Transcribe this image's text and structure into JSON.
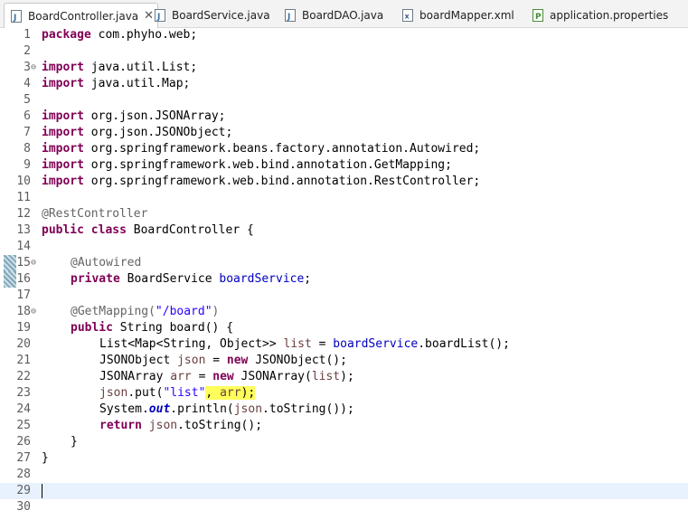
{
  "tabs": [
    {
      "label": "BoardController.java",
      "type": "java",
      "active": true,
      "close": "✕"
    },
    {
      "label": "BoardService.java",
      "type": "java",
      "active": false
    },
    {
      "label": "BoardDAO.java",
      "type": "java",
      "active": false
    },
    {
      "label": "boardMapper.xml",
      "type": "xml",
      "active": false
    },
    {
      "label": "application.properties",
      "type": "properties",
      "active": false
    }
  ],
  "editor": {
    "line_numbers": [
      "1",
      "2",
      "3",
      "4",
      "5",
      "6",
      "7",
      "8",
      "9",
      "10",
      "11",
      "12",
      "13",
      "14",
      "15",
      "16",
      "17",
      "18",
      "19",
      "20",
      "21",
      "22",
      "23",
      "24",
      "25",
      "26",
      "27",
      "28",
      "29",
      "30"
    ],
    "fold_marker": "⊖",
    "code": {
      "l1_kw": "package",
      "l1_rest": " com.phyho.web;",
      "l3_kw": "import",
      "l3_rest": " java.util.List;",
      "l4_kw": "import",
      "l4_rest": " java.util.Map;",
      "l6_kw": "import",
      "l6_rest": " org.json.JSONArray;",
      "l7_kw": "import",
      "l7_rest": " org.json.JSONObject;",
      "l8_kw": "import",
      "l8_rest": " org.springframework.beans.factory.annotation.Autowired;",
      "l9_kw": "import",
      "l9_rest": " org.springframework.web.bind.annotation.GetMapping;",
      "l10_kw": "import",
      "l10_rest": " org.springframework.web.bind.annotation.RestController;",
      "l12_an": "@RestController",
      "l13_kw": "public class",
      "l13_rest": " BoardController {",
      "l15_an": "@Autowired",
      "l16_kw": "private",
      "l16_type": " BoardService ",
      "l16_fld": "boardService",
      "l16_end": ";",
      "l18_an": "@GetMapping(",
      "l18_str": "\"/board\"",
      "l18_end": ")",
      "l19_kw": "public",
      "l19_rest": " String board() {",
      "l20_a": "List<Map<String, Object>> ",
      "l20_loc": "list",
      "l20_b": " = ",
      "l20_fld": "boardService",
      "l20_c": ".boardList();",
      "l21_a": "JSONObject ",
      "l21_loc": "json",
      "l21_b": " = ",
      "l21_kw": "new",
      "l21_c": " JSONObject();",
      "l22_a": "JSONArray ",
      "l22_loc": "arr",
      "l22_b": " = ",
      "l22_kw": "new",
      "l22_c": " JSONArray(",
      "l22_loc2": "list",
      "l22_d": ");",
      "l23_loc": "json",
      "l23_a": ".put(",
      "l23_str": "\"list\"",
      "l23_hl1": ", ",
      "l23_loc2": "arr",
      "l23_hl2": ");",
      "l24_a": "System.",
      "l24_st": "out",
      "l24_b": ".println(",
      "l24_loc": "json",
      "l24_c": ".toString());",
      "l25_kw": "return",
      "l25_sp": " ",
      "l25_loc": "json",
      "l25_a": ".toString();",
      "l26": "}",
      "l27": "}"
    }
  },
  "colors": {
    "keyword": "#7f0055",
    "annotation": "#646464",
    "string": "#2a00ff",
    "field": "#0000c0",
    "highlight": "#ffff5b",
    "current_line": "#e8f2fe"
  }
}
